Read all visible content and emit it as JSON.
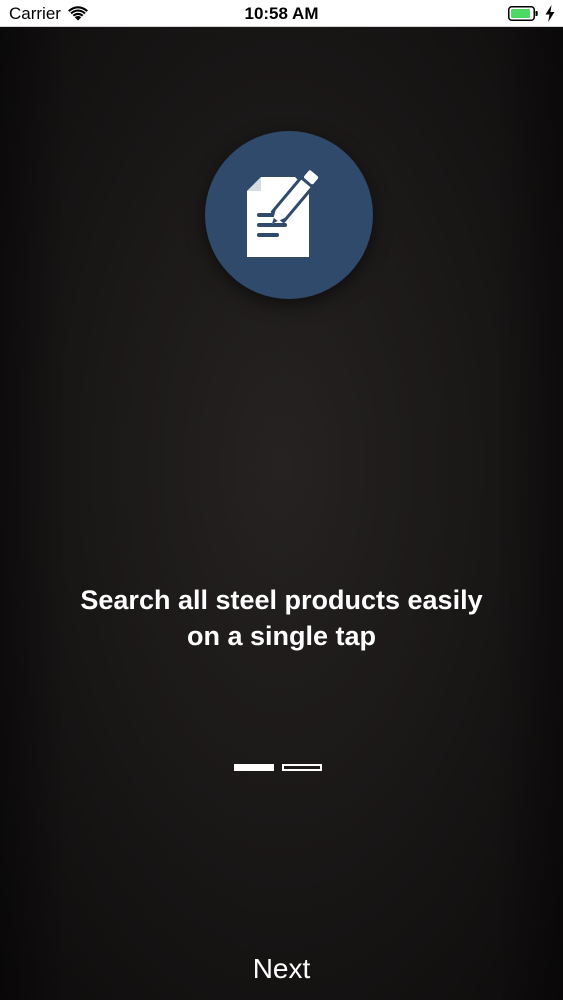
{
  "status_bar": {
    "carrier": "Carrier",
    "time": "10:58 AM",
    "battery_color": "#4cd964"
  },
  "onboarding": {
    "icon": "document-edit-icon",
    "icon_background": "#2f4a6a",
    "headline_line1": "Search all steel products easily",
    "headline_line2": "on a single tap",
    "page_count": 2,
    "current_page": 1,
    "next_label": "Next"
  }
}
